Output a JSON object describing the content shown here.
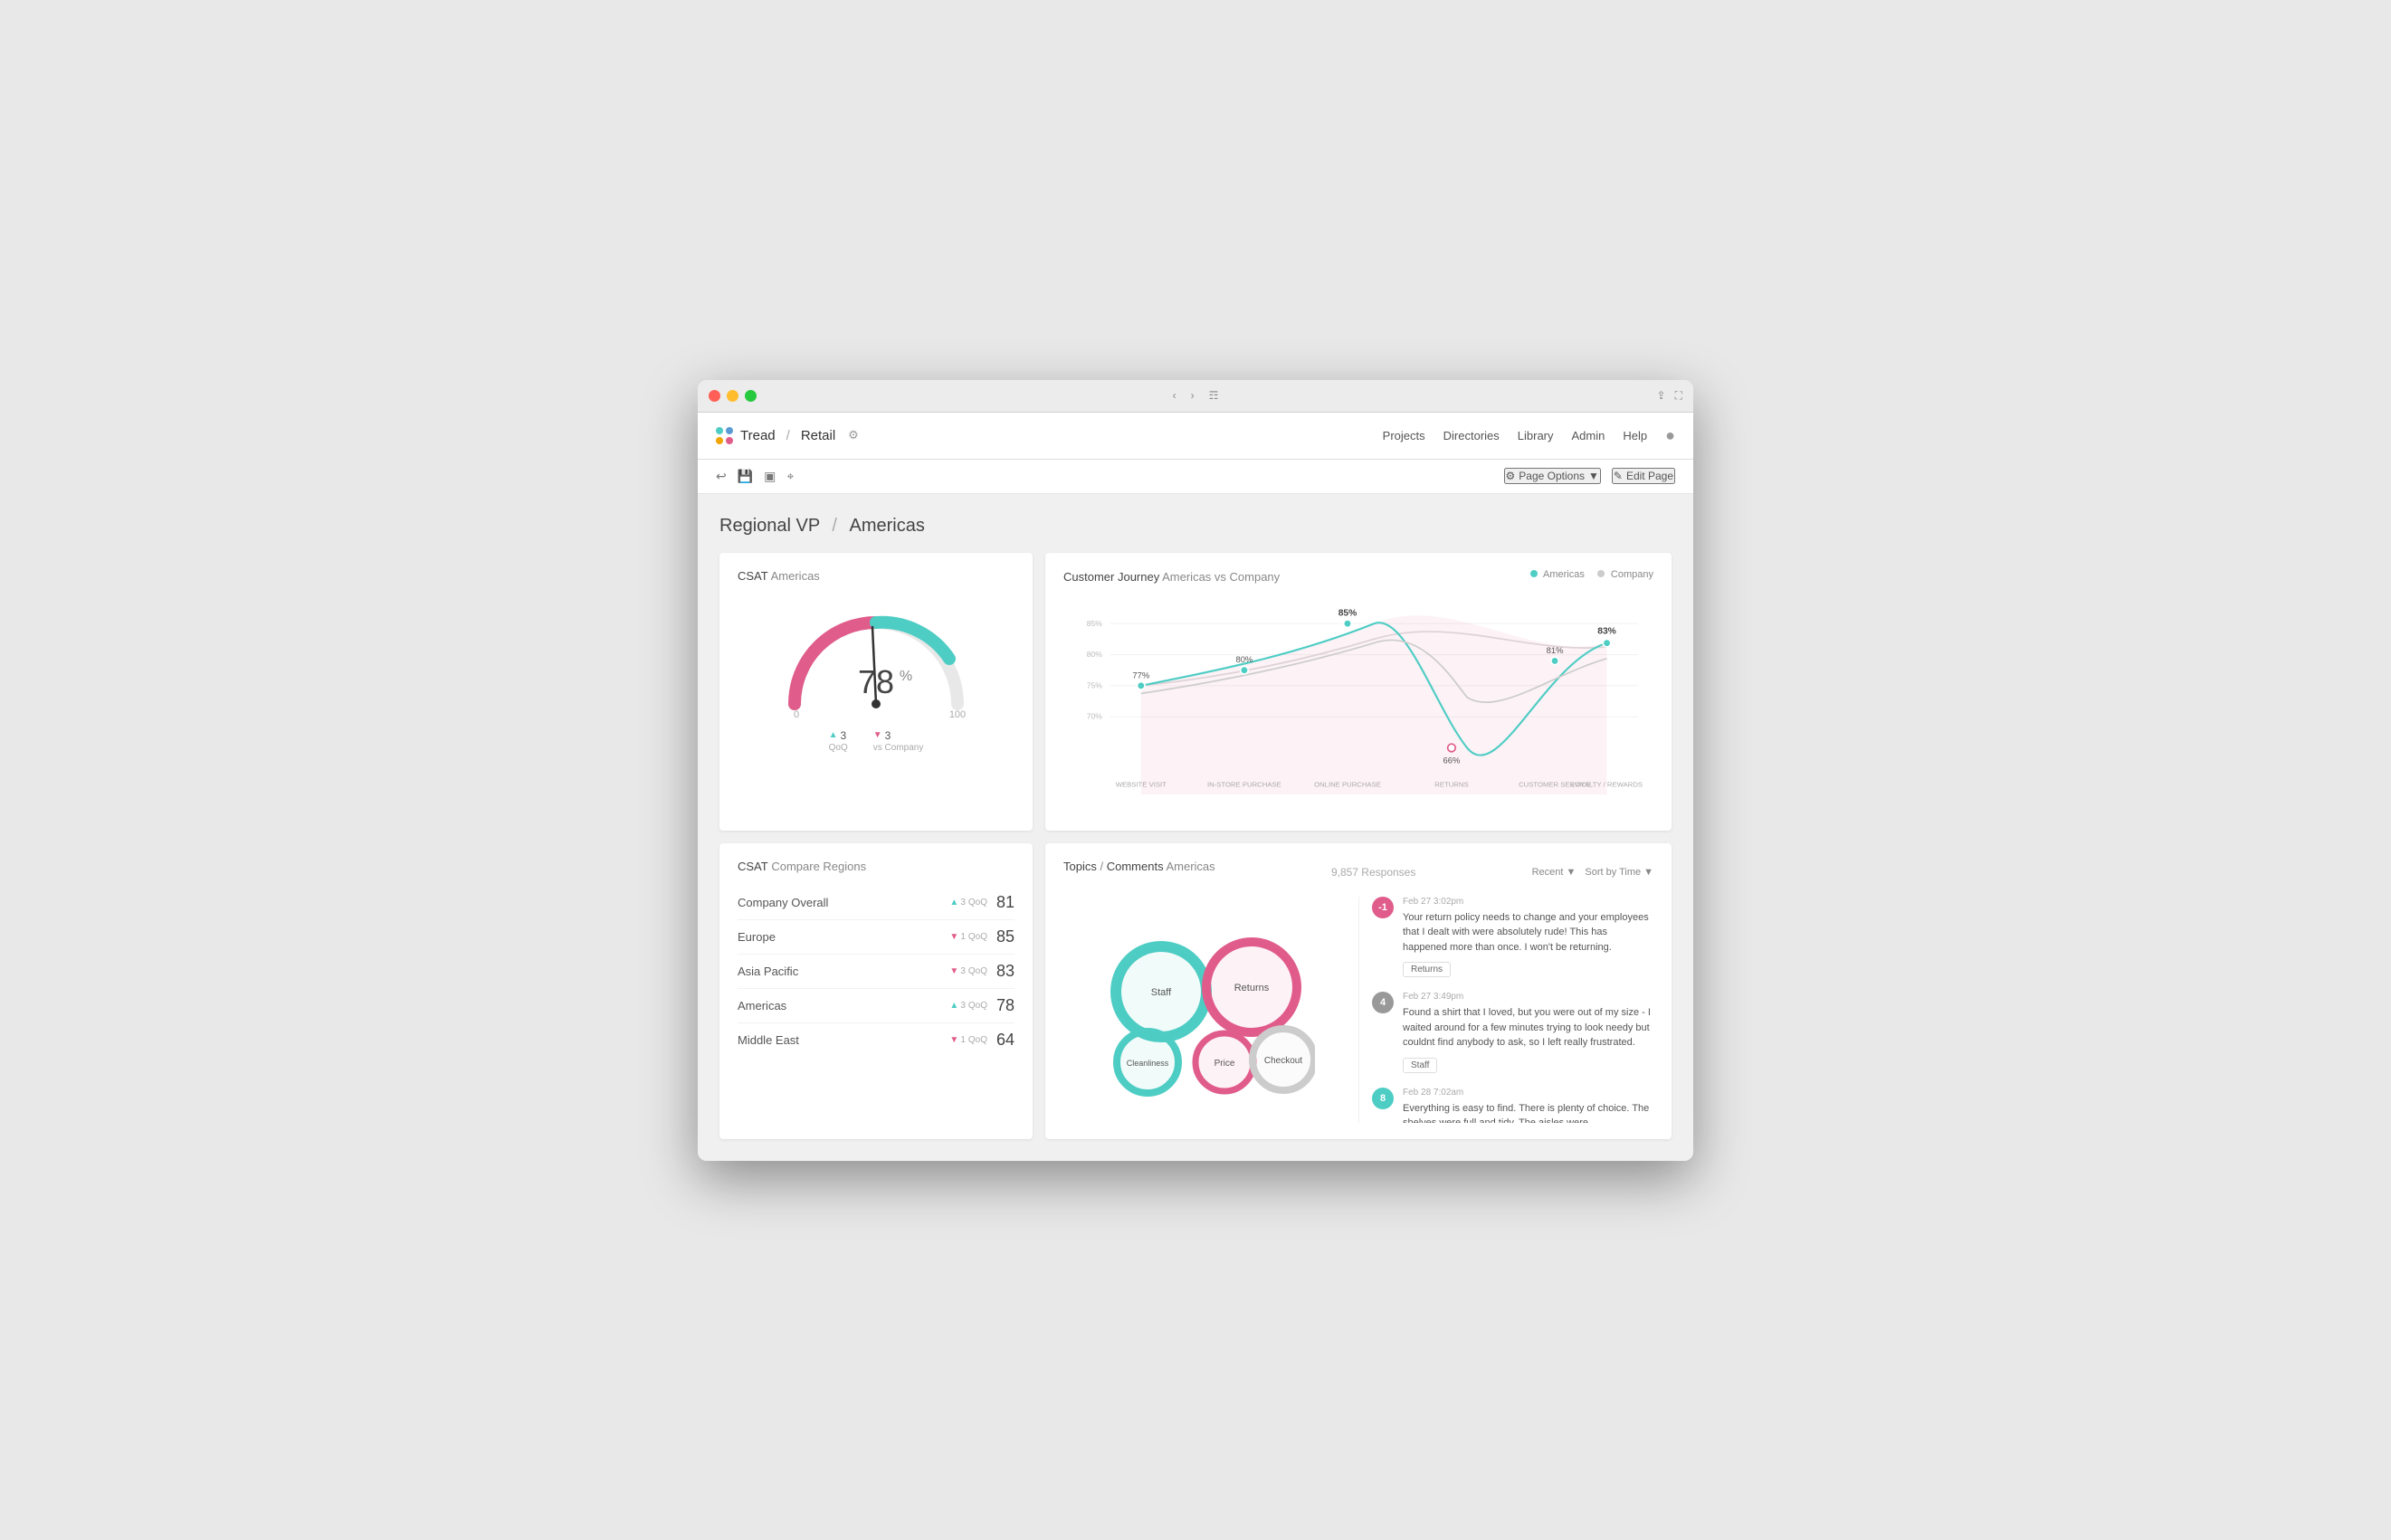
{
  "window": {
    "title": "Tread Retail"
  },
  "navbar": {
    "brand": "Tread",
    "slash": "/",
    "project": "Retail",
    "links": [
      "Projects",
      "Directories",
      "Library",
      "Admin",
      "Help"
    ]
  },
  "toolbar": {
    "page_options": "Page Options",
    "edit_page": "Edit Page"
  },
  "page": {
    "breadcrumb": "Regional VP",
    "region": "Americas"
  },
  "csat_card": {
    "title": "CSAT",
    "subtitle": "Americas",
    "value": "78",
    "unit": "%",
    "min": "0",
    "max": "100",
    "qoq_label": "QoQ",
    "qoq_value": "3",
    "vs_label": "vs Company",
    "vs_value": "3"
  },
  "journey_card": {
    "title": "Customer Journey",
    "subtitle": "Americas vs Company",
    "legend_americas": "Americas",
    "legend_company": "Company",
    "points": [
      {
        "label": "WEBSITE VISIT",
        "americas": 77,
        "company": 75
      },
      {
        "label": "IN-STORE PURCHASE",
        "americas": 80,
        "company": 79
      },
      {
        "label": "ONLINE PURCHASE",
        "americas": 85,
        "company": 82
      },
      {
        "label": "RETURNS",
        "americas": 66,
        "company": 74
      },
      {
        "label": "CUSTOMER SERVICE",
        "americas": 81,
        "company": 77
      },
      {
        "label": "LOYALTY / REWARDS",
        "americas": 83,
        "company": 80
      }
    ],
    "y_labels": [
      "85%",
      "80%",
      "75%",
      "70%"
    ],
    "annotations": {
      "p1": "77%",
      "p2": "80%",
      "p3": "85%",
      "p4": "66%",
      "p5": "81%",
      "p6": "83%"
    }
  },
  "compare_card": {
    "title": "CSAT",
    "subtitle": "Compare Regions",
    "rows": [
      {
        "name": "Company Overall",
        "direction": "up",
        "qoq": "3",
        "score": "81"
      },
      {
        "name": "Europe",
        "direction": "down",
        "qoq": "1",
        "score": "85"
      },
      {
        "name": "Asia Pacific",
        "direction": "down",
        "qoq": "3",
        "score": "83"
      },
      {
        "name": "Americas",
        "direction": "up",
        "qoq": "3",
        "score": "78"
      },
      {
        "name": "Middle East",
        "direction": "down",
        "qoq": "1",
        "score": "64"
      }
    ]
  },
  "topics_card": {
    "title": "Topics",
    "separator": "/",
    "subtitle2": "Comments",
    "subtitle3": "Americas",
    "response_count": "9,857 Responses",
    "recent_label": "Recent",
    "sort_label": "Sort by Time",
    "bubbles": [
      {
        "label": "Staff",
        "color": "#4ecdc4",
        "r": 52
      },
      {
        "label": "Returns",
        "color": "#e05c8a",
        "r": 52
      },
      {
        "label": "Cleanliness",
        "color": "#4ecdc4",
        "r": 38
      },
      {
        "label": "Price",
        "color": "#e05c8a",
        "r": 36
      },
      {
        "label": "Checkout",
        "color": "#ccc",
        "r": 38
      }
    ],
    "comments": [
      {
        "score": "-1",
        "score_type": "red",
        "date": "Feb 27  3:02pm",
        "text": "Your return policy needs to change and your employees that I dealt with were absolutely rude!  This has happened more than once.  I won't be returning.",
        "tag": "Returns"
      },
      {
        "score": "4",
        "score_type": "gray",
        "date": "Feb 27  3:49pm",
        "text": "Found a shirt that I loved, but you were out of my size - I waited around for a few minutes trying to look needy but couldnt find anybody to ask, so I left really frustrated.",
        "tag": "Staff"
      },
      {
        "score": "8",
        "score_type": "teal",
        "date": "Feb 28  7:02am",
        "text": "Everything is easy to find. There is plenty of choice. The shelves were full and tidy. The aisles were",
        "tag": ""
      }
    ]
  },
  "colors": {
    "teal": "#4ecdc4",
    "red": "#e05c8a",
    "green": "#27c93f",
    "accent": "#5b9bd5",
    "light_gray": "#f0f0f0",
    "mid_gray": "#ccc",
    "dark_gray": "#555"
  }
}
